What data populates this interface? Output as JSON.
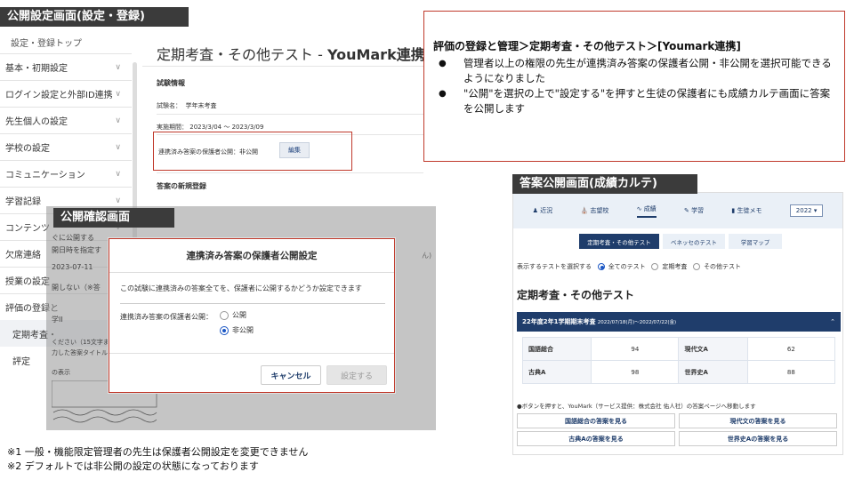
{
  "page_label": "公開設定画面(設定・登録)",
  "sidebar": {
    "top": "設定・登録トップ",
    "items": [
      {
        "label": "基本・初期設定"
      },
      {
        "label": "ログイン設定と外部ID連携"
      },
      {
        "label": "先生個人の設定"
      },
      {
        "label": "学校の設定"
      },
      {
        "label": "コミュニケーション"
      },
      {
        "label": "学習記録"
      },
      {
        "label": "コンテンツ"
      },
      {
        "label": "欠席連絡"
      },
      {
        "label": "授業の設定"
      },
      {
        "label": "評価の登録と"
      }
    ],
    "sub_active": "定期考査・",
    "sub": "評定"
  },
  "main": {
    "title_prefix": "定期考査・その他テスト - ",
    "title_bold": "YouMark連携",
    "section_info": "試験情報",
    "exam_name_label": "試験名：",
    "exam_name": "学年末考査",
    "period_label": "実施期間：",
    "period": "2023/3/04 〜 2023/3/09",
    "publish_status": "連携済み答案の保護者公開：非公開",
    "edit_button": "編集",
    "section_new": "答案の新規登録",
    "publish_now": "ぐに公開する",
    "schedule": "開日時を指定す",
    "date": "2023-07-11",
    "no_publish": "開しない（※答",
    "subject": "学II",
    "caption_hint": "ください（15文字ま",
    "caption_hint2": "力した答案タイトル",
    "show": "の表示",
    "right_fragment": "ん)"
  },
  "callout": {
    "title": "評価の登録と管理＞定期考査・その他テスト＞[Youmark連携]",
    "bullets": [
      "管理者以上の権限の先生が連携済み答案の保護者公開・非公開を選択可能できるようになりました",
      "\"公開\"を選択の上で\"設定する\"を押すと生徒の保護者にも成績カルテ画面に答案を公開します"
    ]
  },
  "confirm_label": "公開確認画面",
  "dialog": {
    "title": "連携済み答案の保護者公開設定",
    "description": "この試験に連携済みの答案全てを、保護者に公開するかどうか設定できます",
    "field_label": "連携済み答案の保護者公開：",
    "option_public": "公開",
    "option_private": "非公開",
    "selected": "非公開",
    "cancel": "キャンセル",
    "submit": "設定する"
  },
  "karte_label": "答案公開画面(成績カルテ)",
  "karte": {
    "nav": [
      {
        "icon": "person-icon",
        "label": "近況"
      },
      {
        "icon": "school-icon",
        "label": "志望校"
      },
      {
        "icon": "chart-icon",
        "label": "成績"
      },
      {
        "icon": "pen-icon",
        "label": "学習"
      },
      {
        "icon": "book-icon",
        "label": "生徒メモ"
      }
    ],
    "year": "2022",
    "tabs": [
      "定期考査・その他テスト",
      "ベネッセのテスト",
      "学習マップ"
    ],
    "filter_label": "表示するテストを選択する",
    "filter_options": [
      "全てのテスト",
      "定期考査",
      "その他テスト"
    ],
    "section_title": "定期考査・その他テスト",
    "exam_title": "22年度2年1学期期末考査",
    "exam_period": "2022/07/18(月)〜2022/07/22(金)",
    "scores": [
      {
        "subject": "国語総合",
        "score": "94"
      },
      {
        "subject": "現代文A",
        "score": "62"
      },
      {
        "subject": "古典A",
        "score": "98"
      },
      {
        "subject": "世界史A",
        "score": "88"
      }
    ],
    "note": "●ボタンを押すと、YouMark（サービス提供：株式会社 佑人社）の答案ページへ移動します",
    "answer_buttons": [
      "国語総合の答案を見る",
      "現代文の答案を見る",
      "古典Aの答案を見る",
      "世界史Aの答案を見る"
    ]
  },
  "footnotes": [
    "※1 一般・機能限定管理者の先生は保護者公開設定を変更できません",
    "※2 デフォルトでは非公開の設定の状態になっております"
  ]
}
